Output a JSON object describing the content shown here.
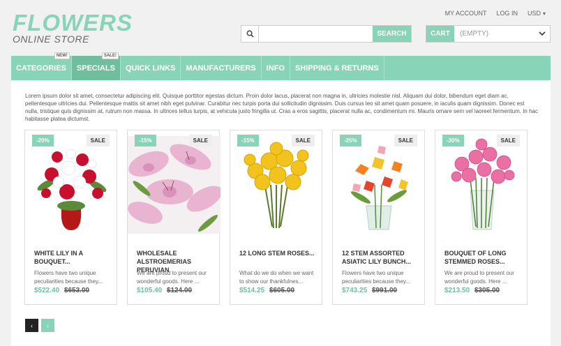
{
  "logo": {
    "main": "FLOWERS",
    "sub": "ONLINE STORE"
  },
  "toplinks": {
    "account": "MY ACCOUNT",
    "login": "LOG IN",
    "currency": "USD"
  },
  "search": {
    "placeholder": "",
    "button": "SEARCH",
    "icon": "search-icon"
  },
  "cart": {
    "label": "CART",
    "status": "(EMPTY)"
  },
  "nav": {
    "items": [
      {
        "label": "CATEGORIES",
        "badge": "NEW!"
      },
      {
        "label": "SPECIALS",
        "badge": "SALE!"
      },
      {
        "label": "QUICK LINKS"
      },
      {
        "label": "MANUFACTURERS"
      },
      {
        "label": "INFO"
      },
      {
        "label": "SHIPPING & RETURNS"
      }
    ]
  },
  "intro": "Lorem ipsum dolor sit amet, consectetur adipiscing elit. Quisque porttitor egestas dictum. Proin dolor lacus, placerat non magna in, ultricies molestie nisl. Aliquam dui dolor, bibendum eget diam ac, pellentesque ultricies dui. Pellentesque mattis sit amet nibh eget pulvinar. Curabitur nec turpis porta dui sollicitudin dignissim. Duis cursus leo sit amet quam posuere, in iaculis quam dignissim. Donec est nulla, tristique quis dignissim at, rutrum non massa. In ultrices tellus turpis, at vehicula justo fringilla ut. Cras a eros sagittis, placerat nulla ac, condimentum mi. Mauris ornare sem vel laoreet fermentum. In hac habitasse platea dictumst.",
  "products": [
    {
      "discount": "-20%",
      "sale": "SALE",
      "title": "WHITE LILY IN A BOUQUET...",
      "desc": "Flowers have two unique peculiarities because they...",
      "price": "$522.40",
      "old": "$653.00"
    },
    {
      "discount": "-15%",
      "sale": "SALE",
      "title": "WHOLESALE ALSTROEMERIAS PERUVIAN",
      "desc": "We are proud to present our wonderful goods. Here ...",
      "price": "$105.40",
      "old": "$124.00"
    },
    {
      "discount": "-15%",
      "sale": "SALE",
      "title": "12 LONG STEM ROSES...",
      "desc": "What do we do when we want to show our thankfulnes...",
      "price": "$514.25",
      "old": "$605.00"
    },
    {
      "discount": "-25%",
      "sale": "SALE",
      "title": "12 STEM ASSORTED ASIATIC LILY BUNCH...",
      "desc": "Flowers have two unique peculiarities because they...",
      "price": "$743.25",
      "old": "$991.00"
    },
    {
      "discount": "-30%",
      "sale": "SALE",
      "title": "BOUQUET OF LONG STEMMED ROSES...",
      "desc": "We are proud to present our wonderful goods. Here ...",
      "price": "$213.50",
      "old": "$305.00"
    }
  ],
  "pager": {
    "prev": "‹",
    "next": "›"
  },
  "colors": {
    "accent": "#88d4b8",
    "accent_dark": "#6fbf9f"
  }
}
